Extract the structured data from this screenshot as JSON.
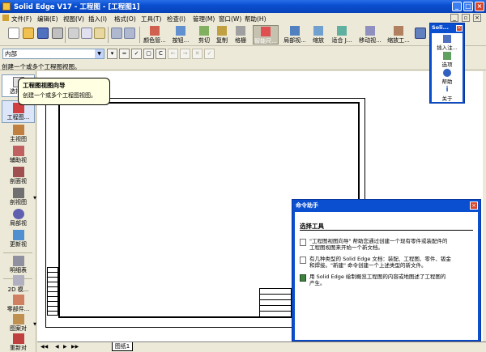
{
  "window": {
    "title": "Solid Edge V17 - 工程图 - [工程图1]"
  },
  "menu": {
    "items": [
      "文件(F)",
      "编辑(E)",
      "视图(V)",
      "插入(I)",
      "格式(O)",
      "工具(T)",
      "检查(I)",
      "管理(M)",
      "窗口(W)",
      "帮助(H)"
    ]
  },
  "toolbar": {
    "buttons": [
      "颜色管...",
      "按钮...",
      "剪切",
      "复制",
      "粘贴",
      "格栅",
      "测量",
      "局部视...",
      "缩放",
      "适合 J...",
      "移动视...",
      "缩放工..."
    ],
    "labels": {
      "b0": "颜色管...",
      "b1": "按钮...",
      "b2": "剪切",
      "b3": "复制",
      "b4": "粘贴",
      "b5": "格栅",
      "b6": "测量",
      "b7": "局部视...",
      "b8": "缩放",
      "b9": "适合 J...",
      "b10": "移动视...",
      "b11": "缩放工..."
    },
    "pressed_label": "智能尺..."
  },
  "toolbar2": {
    "layer_value": "内部"
  },
  "prompt": {
    "text": "创建一个或多个工程图视图。"
  },
  "leftbar": {
    "items": {
      "i0": "选择工",
      "i1": "工程图...",
      "i2": "主视图",
      "i3": "辅助视",
      "i4": "剖面视",
      "i5": "剖视图",
      "i6": "局部视",
      "i7": "更新视",
      "i8": "明细表",
      "i9": "2D 模...",
      "i10": "零部件...",
      "i11": "图案对",
      "i12": "重新对"
    }
  },
  "tooltip": {
    "title": "工程图视图向导",
    "desc": "创建一个或多个工程图视图。"
  },
  "palette": {
    "title": "Soli...",
    "items": {
      "p0": "插入注...",
      "p1": "选项",
      "p2": "帮助",
      "p3": "关于"
    }
  },
  "command_assistant": {
    "title": "命令助手",
    "heading": "选择工具",
    "entries": {
      "e0a": "\"工程图视图向导\" 帮助您通过创建一个现有零件或装配件的",
      "e0b": "工程图视图来开始一个新文档。",
      "e1a": "有几种类型的 Solid Edge 文档：装配、工程图、零件、钣金",
      "e1b": "和焊接。\"新建\" 命令创建一个上述类型的新文件。",
      "e2a": "用 Solid Edge 绘制概览工程图的内容或地图述了工程图的",
      "e2b": "产生。"
    }
  },
  "sheet_tabs": {
    "active": "图纸1"
  },
  "colors": {
    "titlebar": "#0a4fd0",
    "background": "#ece9d8",
    "tooltip_bg": "#ffffe1"
  }
}
